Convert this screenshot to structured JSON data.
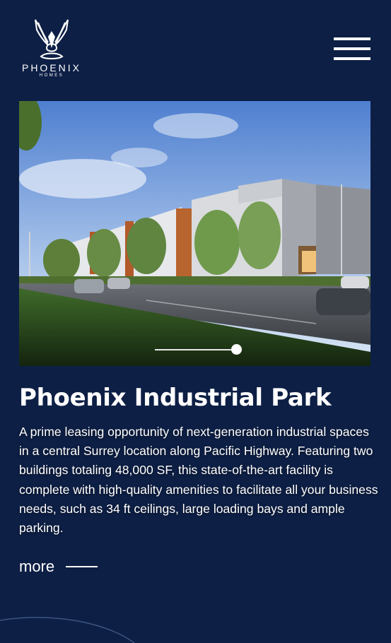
{
  "brand": {
    "name": "PHOENIX",
    "sub": "HOMES",
    "logo_icon": "phoenix-bird-logo"
  },
  "header": {
    "menu_icon": "hamburger-menu-icon"
  },
  "hero": {
    "image_subject": "industrial buildings street rendering",
    "slider_position": 1.0
  },
  "project": {
    "title": "Phoenix Industrial Park",
    "description": "A prime leasing opportunity of next-generation industrial spaces in a central Surrey location along Pacific Highway. Featuring two buildings totaling 48,000 SF, this state-of-the-art facility is complete with high-quality amenities to facilitate all your business needs, such as 34 ft ceilings, large loading bays and ample parking.",
    "more_label": "more"
  },
  "colors": {
    "background": "#0d1f45",
    "text": "#ffffff"
  }
}
